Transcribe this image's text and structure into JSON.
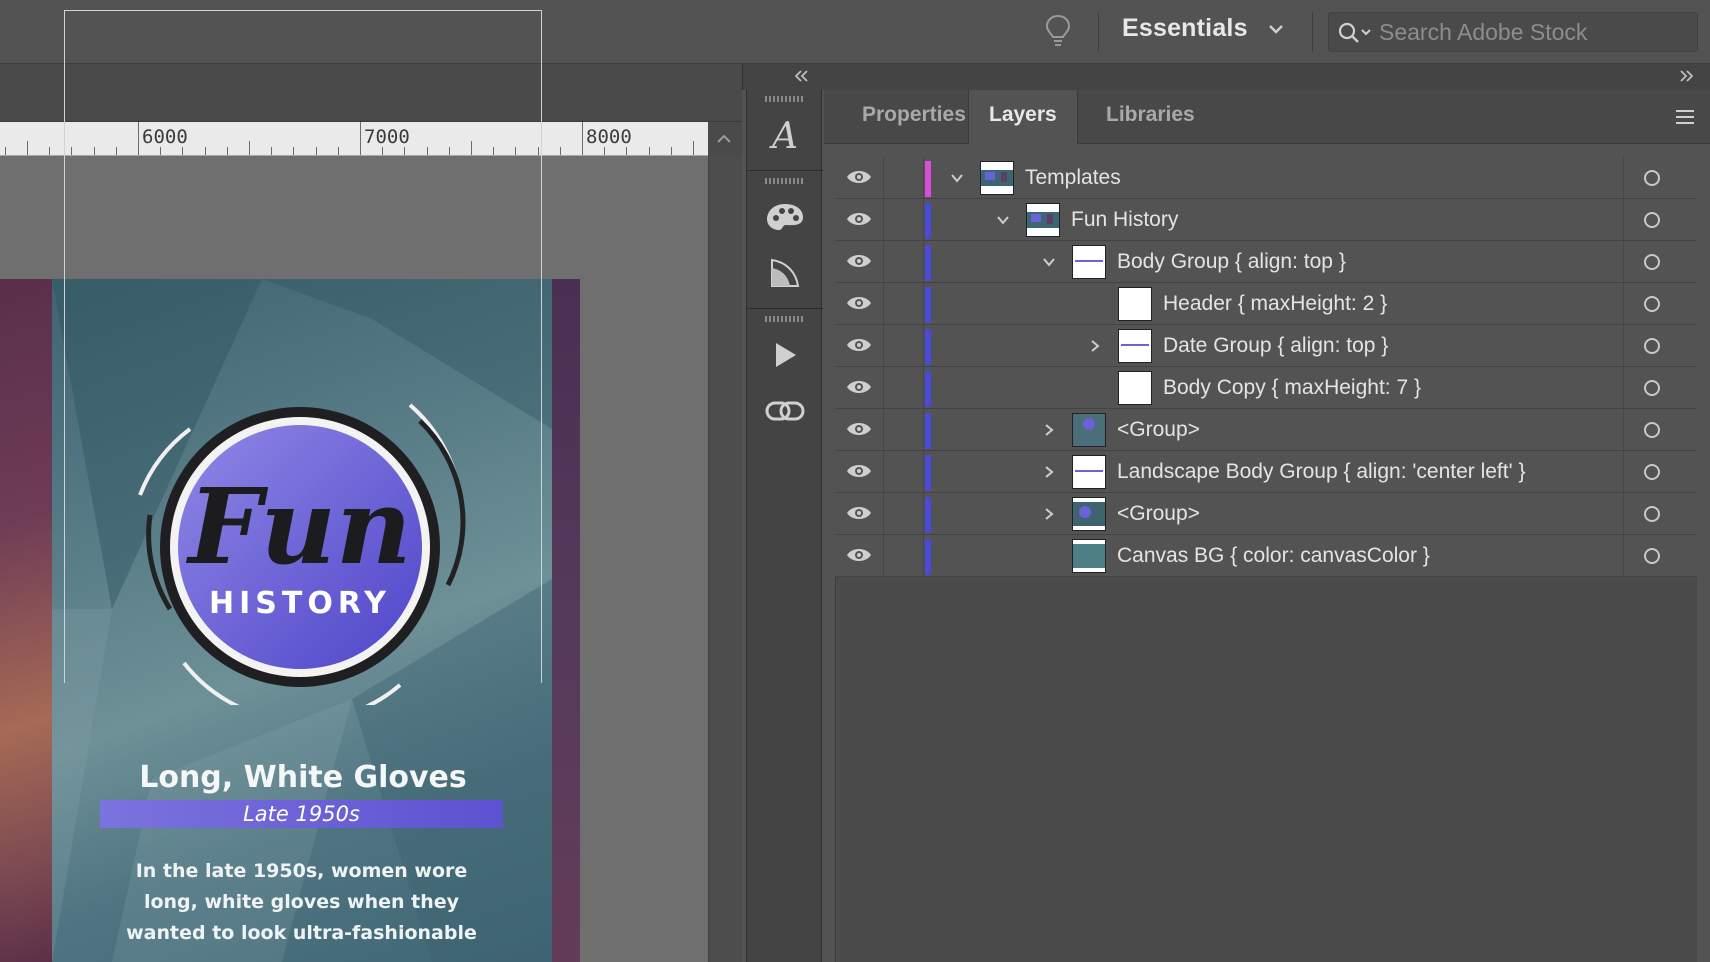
{
  "topbar": {
    "workspace_label": "Essentials",
    "search_placeholder": "Search Adobe Stock"
  },
  "ruler": {
    "labels": [
      "6000",
      "7000",
      "8000"
    ]
  },
  "artboard": {
    "logo_word": "Fun",
    "logo_subword": "HISTORY",
    "title": "Long, White Gloves",
    "date": "Late 1950s",
    "body_lines": [
      "In the late 1950s, women wore",
      "long, white gloves when they",
      "wanted to look ultra-fashionable"
    ]
  },
  "panel": {
    "tabs": [
      "Properties",
      "Layers",
      "Libraries"
    ],
    "active_tab": "Layers"
  },
  "layers": [
    {
      "name": "Templates",
      "expanded": true,
      "color": "#d94ddb"
    },
    {
      "name": "Fun History",
      "expanded": true,
      "color": "#4b4bd9"
    },
    {
      "name": "Body Group { align: top }",
      "expanded": true,
      "color": "#4b4bd9"
    },
    {
      "name": "Header { maxHeight: 2 }",
      "expanded": null,
      "color": "#4b4bd9"
    },
    {
      "name": "Date Group { align: top }",
      "expanded": false,
      "color": "#4b4bd9"
    },
    {
      "name": "Body Copy { maxHeight: 7 }",
      "expanded": null,
      "color": "#4b4bd9"
    },
    {
      "name": "<Group>",
      "expanded": false,
      "color": "#4b4bd9"
    },
    {
      "name": "Landscape Body Group { align: 'center left' }",
      "expanded": false,
      "color": "#4b4bd9"
    },
    {
      "name": "<Group>",
      "expanded": false,
      "color": "#4b4bd9"
    },
    {
      "name": "Canvas BG { color: canvasColor }",
      "expanded": null,
      "color": "#4b4bd9"
    }
  ],
  "colors": {
    "ui_bg": "#535353",
    "accent_purple": "#5d52d0",
    "layer_templates": "#d94ddb",
    "layer_blue": "#4b4bd9"
  }
}
